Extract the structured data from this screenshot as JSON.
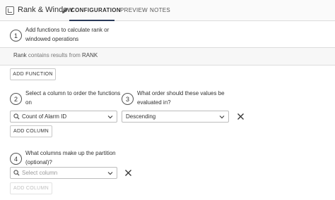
{
  "header": {
    "title": "Rank & Window",
    "tabs": [
      {
        "label": "CONFIGURATION"
      },
      {
        "label": "PREVIEW"
      },
      {
        "label": "NOTES"
      }
    ]
  },
  "steps": [
    {
      "number": "1",
      "line1": "Add functions to calculate rank or",
      "line2": "windowed operations"
    },
    {
      "number": "2",
      "line1": "Select a column to order the functions",
      "line2": "on"
    },
    {
      "number": "3",
      "line1": "What order should these values be",
      "line2": "evaluated in?"
    },
    {
      "number": "4",
      "line1": "What columns make up the partition",
      "line2": "(optional)?"
    }
  ],
  "rank_row": {
    "name": "Rank",
    "middle": "contains results from",
    "source": "RANK"
  },
  "buttons": {
    "add_function": "ADD FUNCTION",
    "add_column_order": "ADD COLUMN",
    "add_column_partition": "ADD COLUMN"
  },
  "order_column_select": {
    "value": "Count of Alarm ID"
  },
  "order_direction_select": {
    "value": "Descending"
  },
  "partition_select": {
    "placeholder": "Select column"
  },
  "icons": {
    "header": "table-icon",
    "edit": "pencil-icon",
    "search": "search-icon",
    "dropdown": "chevron-down-icon",
    "remove": "close-icon"
  }
}
